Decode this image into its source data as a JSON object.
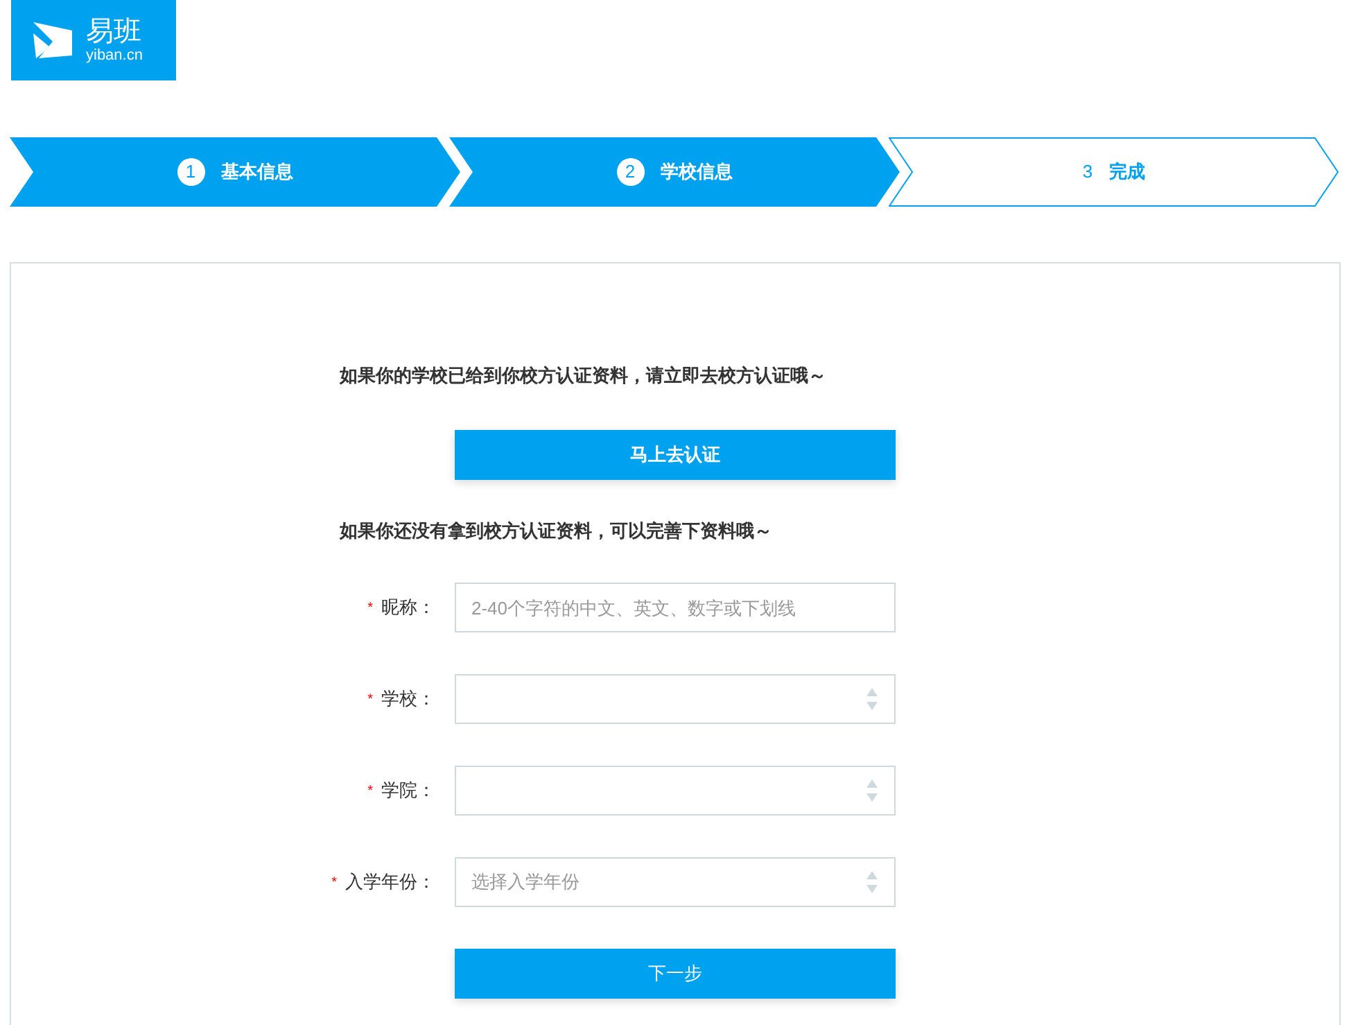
{
  "logo": {
    "name": "易班",
    "domain": "yiban.cn"
  },
  "steps": [
    {
      "number": "1",
      "label": "基本信息",
      "done": true
    },
    {
      "number": "2",
      "label": "学校信息",
      "done": true
    },
    {
      "number": "3",
      "label": "完成",
      "done": false
    }
  ],
  "intro": "如果你的学校已给到你校方认证资料，请立即去校方认证哦～",
  "verify_button": "马上去认证",
  "alt_intro": "如果你还没有拿到校方认证资料，可以完善下资料哦～",
  "fields": [
    {
      "kind": "text",
      "required": true,
      "mark": "*",
      "label": "昵称：",
      "placeholder": "2-40个字符的中文、英文、数字或下划线"
    },
    {
      "kind": "select",
      "required": true,
      "mark": "*",
      "label": "学校："
    },
    {
      "kind": "select",
      "required": true,
      "mark": "*",
      "label": "学院："
    },
    {
      "kind": "select",
      "required": true,
      "mark": "*",
      "label": "入学年份：",
      "placeholder": "选择入学年份"
    }
  ],
  "next_button": "下一步"
}
